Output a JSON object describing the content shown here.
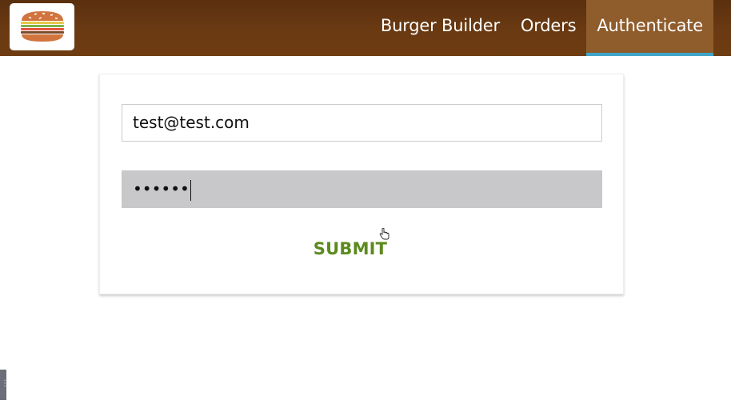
{
  "logo": {
    "icon": "burger-logo-icon"
  },
  "nav": {
    "items": [
      {
        "label": "Burger Builder",
        "active": false
      },
      {
        "label": "Orders",
        "active": false
      },
      {
        "label": "Authenticate",
        "active": true
      }
    ],
    "active_color": "#8f5c2c",
    "active_underline": "#40a4c8"
  },
  "auth": {
    "email_value": "test@test.com",
    "password_masked": "••••••",
    "submit_label": "SUBMIT",
    "submit_color": "#5c8a1f"
  },
  "colors": {
    "toolbar": "#6a3a12",
    "password_field_bg": "#c8c7c9"
  },
  "side_handle": {
    "glyph": "⋮"
  }
}
